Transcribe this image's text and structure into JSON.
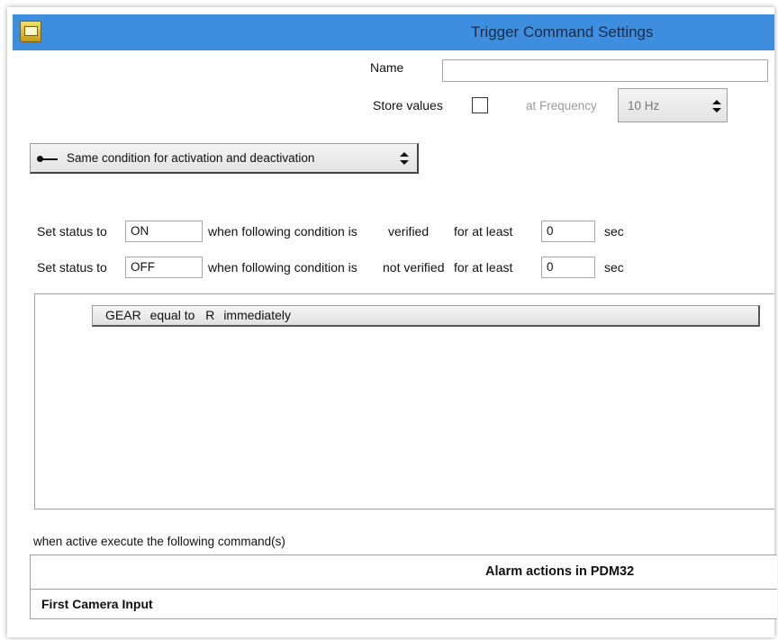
{
  "window": {
    "title": "Trigger Command Settings"
  },
  "name_field": {
    "label": "Name",
    "value": ""
  },
  "store_values": {
    "label": "Store values",
    "checked": false
  },
  "frequency": {
    "label": "at Frequency",
    "selected": "10 Hz"
  },
  "mode_select": {
    "icon": "connector-icon",
    "selected": "Same condition for activation and deactivation"
  },
  "rows": [
    {
      "prefix": "Set status to",
      "status": "ON",
      "mid": "when following condition is",
      "condition": "verified",
      "for_label": "for at least",
      "seconds": "0",
      "unit": "sec"
    },
    {
      "prefix": "Set status to",
      "status": "OFF",
      "mid": "when following condition is",
      "condition": "not verified",
      "for_label": "for at least",
      "seconds": "0",
      "unit": "sec"
    }
  ],
  "condition_item": {
    "variable": "GEAR",
    "operator": "equal to",
    "value": "R",
    "timing": "immediately"
  },
  "commands": {
    "label": "when active execute the following command(s)",
    "header": "Alarm actions in PDM32",
    "items": [
      "First Camera Input"
    ]
  },
  "colors": {
    "titlebar": "#3d8ede",
    "title_text": "#1c2c48"
  }
}
